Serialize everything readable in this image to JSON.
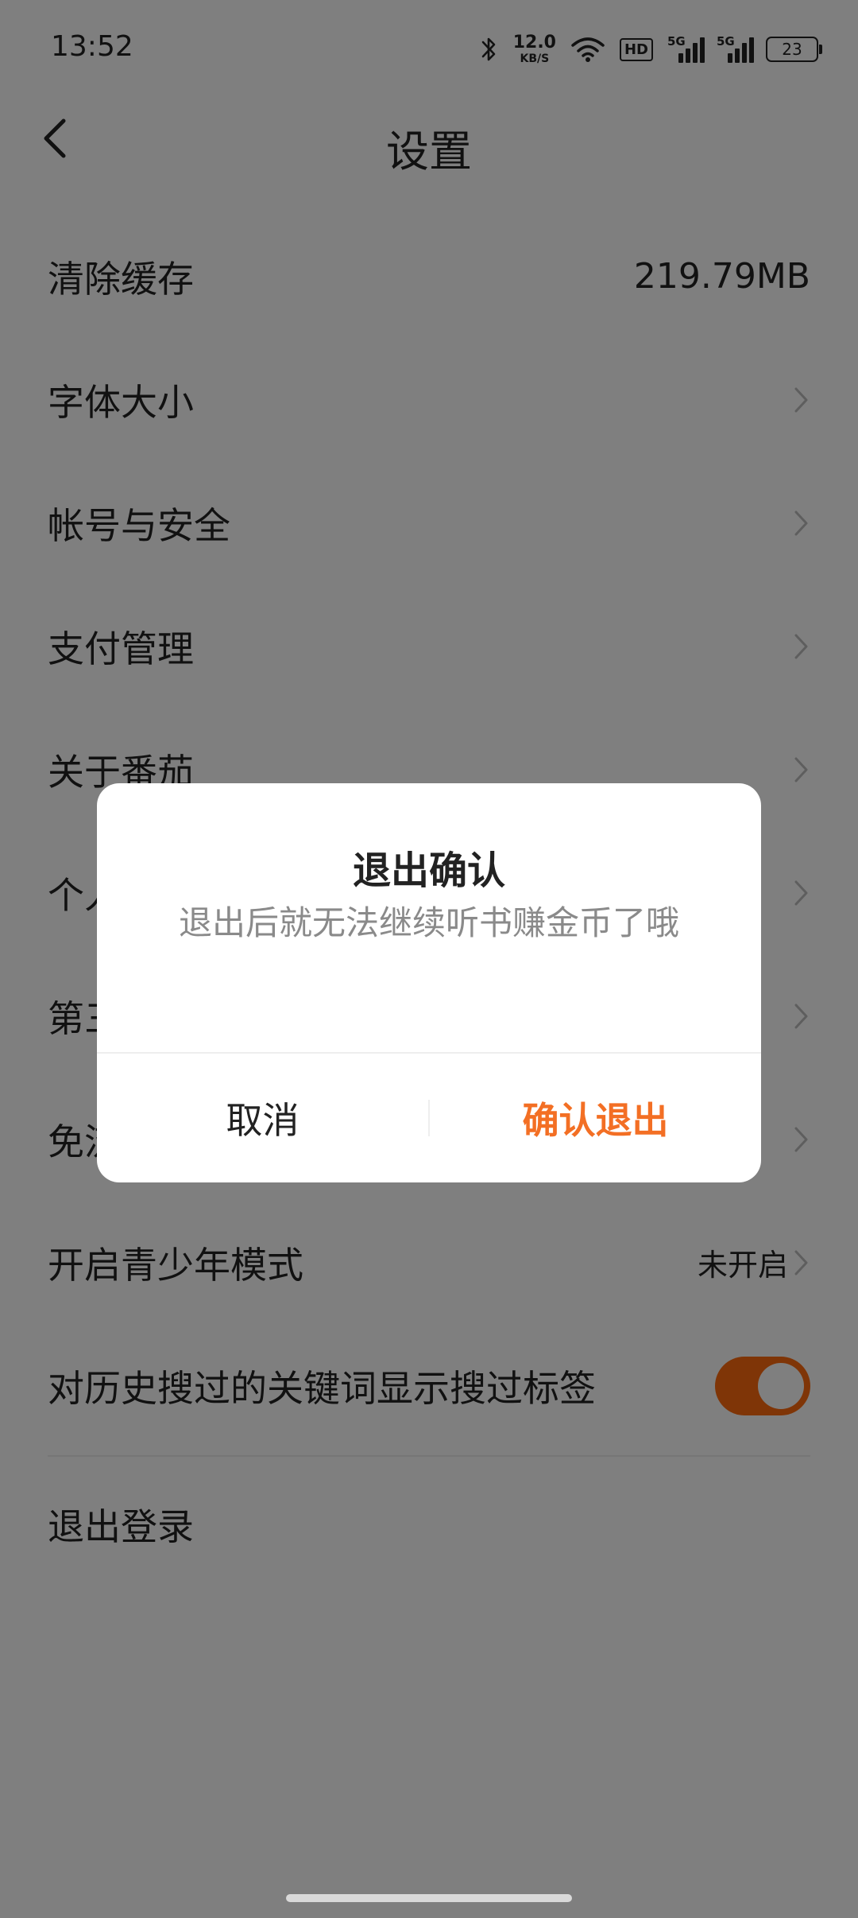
{
  "status_bar": {
    "time": "13:52",
    "net_speed_value": "12.0",
    "net_speed_unit": "KB/S",
    "hd_label": "HD",
    "signal_1_label": "5G",
    "signal_2_label": "5G",
    "battery_level": "23",
    "icons": [
      "bluetooth-icon",
      "wifi-icon",
      "signal-icon",
      "battery-icon"
    ]
  },
  "nav": {
    "title": "设置",
    "back_icon": "chevron-left-icon"
  },
  "settings": {
    "clear_cache": {
      "label": "清除缓存",
      "value": "219.79MB"
    },
    "font_size": {
      "label": "字体大小"
    },
    "account_security": {
      "label": "帐号与安全"
    },
    "payment": {
      "label": "支付管理"
    },
    "about": {
      "label": "关于番茄"
    },
    "personal": {
      "label": "个人"
    },
    "third_party": {
      "label": "第三"
    },
    "free": {
      "label": "免流"
    },
    "teen_mode": {
      "label": "开启青少年模式",
      "status": "未开启"
    },
    "search_tag": {
      "label": "对历史搜过的关键词显示搜过标签",
      "enabled": true
    },
    "logout": {
      "label": "退出登录"
    }
  },
  "dialog": {
    "title": "退出确认",
    "message": "退出后就无法继续听书赚金币了哦",
    "cancel_label": "取消",
    "confirm_label": "确认退出"
  },
  "colors": {
    "accent": "#f36f24",
    "toggle_on": "#ff6a0e",
    "overlay": "rgba(0,0,0,0.5)",
    "text_primary": "#222222",
    "text_secondary": "#8a8a8a"
  }
}
